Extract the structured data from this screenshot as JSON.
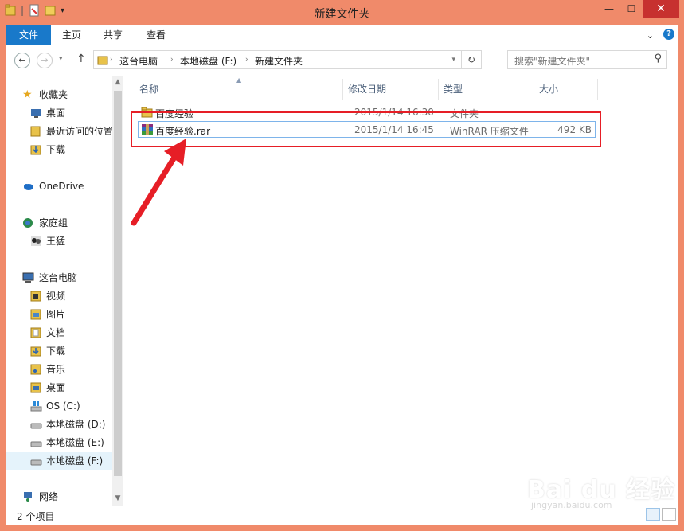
{
  "window": {
    "title": "新建文件夹",
    "close_label": "✕",
    "minimize_label": "—",
    "maximize_label": "☐"
  },
  "ribbon": {
    "tabs": [
      {
        "label": "文件"
      },
      {
        "label": "主页"
      },
      {
        "label": "共享"
      },
      {
        "label": "查看"
      }
    ],
    "help_label": "?"
  },
  "address": {
    "crumbs": [
      "这台电脑",
      "本地磁盘 (F:)",
      "新建文件夹"
    ]
  },
  "search": {
    "placeholder": "搜索\"新建文件夹\""
  },
  "sidebar": {
    "items": [
      {
        "label": "收藏夹"
      },
      {
        "label": "桌面"
      },
      {
        "label": "最近访问的位置"
      },
      {
        "label": "下载"
      },
      {
        "label": "OneDrive"
      },
      {
        "label": "家庭组"
      },
      {
        "label": "王猛"
      },
      {
        "label": "这台电脑"
      },
      {
        "label": "视频"
      },
      {
        "label": "图片"
      },
      {
        "label": "文档"
      },
      {
        "label": "下载"
      },
      {
        "label": "音乐"
      },
      {
        "label": "桌面"
      },
      {
        "label": "OS (C:)"
      },
      {
        "label": "本地磁盘 (D:)"
      },
      {
        "label": "本地磁盘 (E:)"
      },
      {
        "label": "本地磁盘 (F:)"
      },
      {
        "label": "网络"
      }
    ]
  },
  "columns": {
    "name": "名称",
    "modified": "修改日期",
    "type": "类型",
    "size": "大小"
  },
  "files": [
    {
      "name": "百度经验",
      "modified": "2015/1/14 16:30",
      "type": "文件夹",
      "size": ""
    },
    {
      "name": "百度经验.rar",
      "modified": "2015/1/14 16:45",
      "type": "WinRAR 压缩文件",
      "size": "492 KB"
    }
  ],
  "status": {
    "count": "2 个项目"
  },
  "watermark": {
    "brand": "Bai du 经验",
    "url": "jingyan.baidu.com"
  },
  "colors": {
    "titlebar": "#f08a6a",
    "accent": "#1979ca",
    "annotation": "#e61e26"
  }
}
